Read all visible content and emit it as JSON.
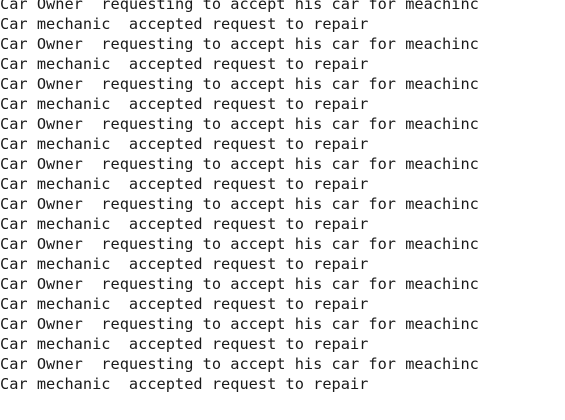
{
  "console": {
    "lines": [
      "Car Owner  requesting to accept his car for meachinc",
      "Car mechanic  accepted request to repair",
      "Car Owner  requesting to accept his car for meachinc",
      "Car mechanic  accepted request to repair",
      "Car Owner  requesting to accept his car for meachinc",
      "Car mechanic  accepted request to repair",
      "Car Owner  requesting to accept his car for meachinc",
      "Car mechanic  accepted request to repair",
      "Car Owner  requesting to accept his car for meachinc",
      "Car mechanic  accepted request to repair",
      "Car Owner  requesting to accept his car for meachinc",
      "Car mechanic  accepted request to repair",
      "Car Owner  requesting to accept his car for meachinc",
      "Car mechanic  accepted request to repair",
      "Car Owner  requesting to accept his car for meachinc",
      "Car mechanic  accepted request to repair",
      "Car Owner  requesting to accept his car for meachinc",
      "Car mechanic  accepted request to repair",
      "Car Owner  requesting to accept his car for meachinc",
      "Car mechanic  accepted request to repair"
    ]
  }
}
